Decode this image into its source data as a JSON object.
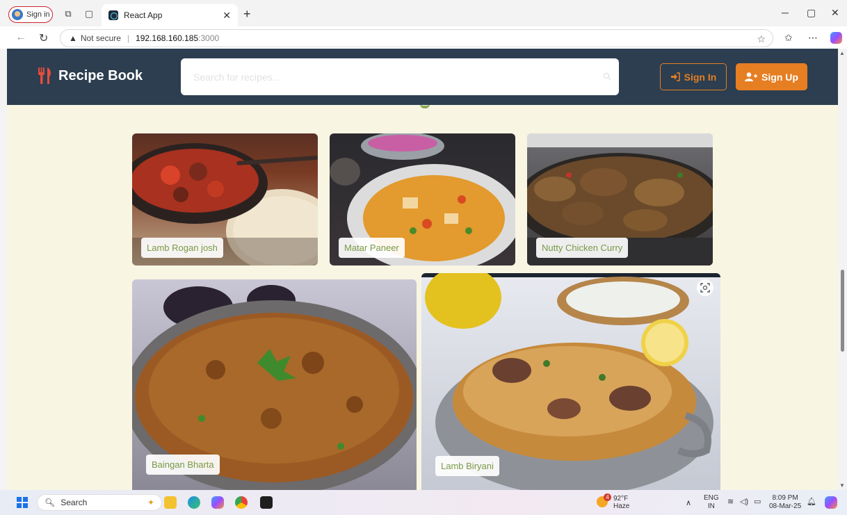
{
  "browser": {
    "profile_label": "Sign in",
    "tab_title": "React App",
    "security_label": "Not secure",
    "url_host": "192.168.160.185",
    "url_port": ":3000"
  },
  "header": {
    "brand": "Recipe Book",
    "search_placeholder": "Search for recipes...",
    "signin_label": "Sign In",
    "signup_label": "Sign Up"
  },
  "recipes": [
    {
      "name": "Lamb Rogan josh"
    },
    {
      "name": "Matar Paneer"
    },
    {
      "name": "Nutty Chicken Curry"
    },
    {
      "name": "Baingan Bharta"
    },
    {
      "name": "Lamb Biryani"
    }
  ],
  "colors": {
    "header_bg": "#2c3e50",
    "accent": "#e67e22",
    "page_bg": "#f8f5e3",
    "label_text": "#7a9a45"
  },
  "taskbar": {
    "search_label": "Search",
    "weather_temp": "92°F",
    "weather_cond": "Haze",
    "weather_badge": "4",
    "lang_top": "ENG",
    "lang_bottom": "IN",
    "time": "8:09 PM",
    "date": "08-Mar-25"
  }
}
